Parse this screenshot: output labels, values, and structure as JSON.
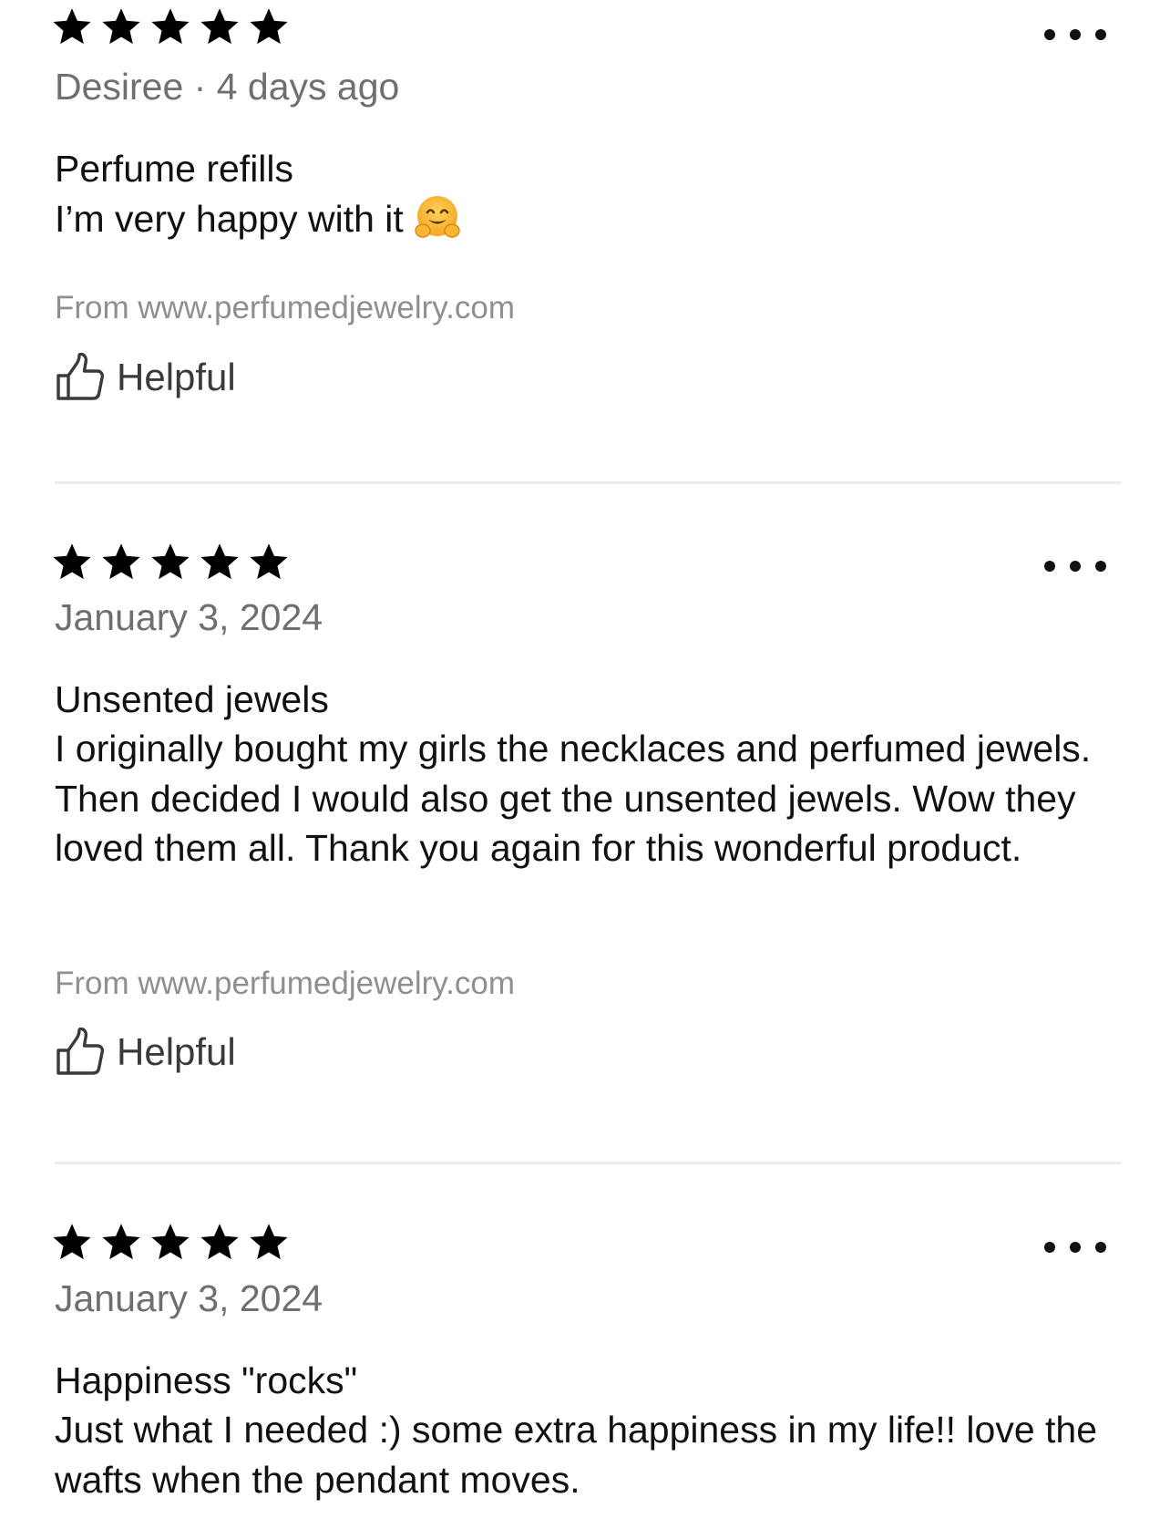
{
  "reviews": [
    {
      "rating": 5,
      "meta": "Desiree · 4 days ago",
      "title": "Perfume refills",
      "body": "I’m very happy with it",
      "emoji": "hugging-face",
      "source": "From www.perfumedjewelry.com",
      "helpful_label": "Helpful"
    },
    {
      "rating": 5,
      "meta": "January 3, 2024",
      "title": "Unsented jewels",
      "body": "I originally bought my girls the necklaces and perfumed jewels. Then decided I would also get the unsented jewels. Wow they loved them all. Thank you again for this wonderful product.",
      "source": "From www.perfumedjewelry.com",
      "helpful_label": "Helpful"
    },
    {
      "rating": 5,
      "meta": "January 3, 2024",
      "title": "Happiness \"rocks\"",
      "body": "Just what I needed :) some extra happiness in my life!! love the wafts when the pendant moves."
    }
  ],
  "icons": {
    "star": "star-icon",
    "more": "more-icon",
    "helpful": "thumbs-up-icon"
  },
  "colors": {
    "star": "#000000",
    "meta_text": "#6e6e73",
    "source_text": "#8e8e93",
    "divider": "#ececec"
  }
}
